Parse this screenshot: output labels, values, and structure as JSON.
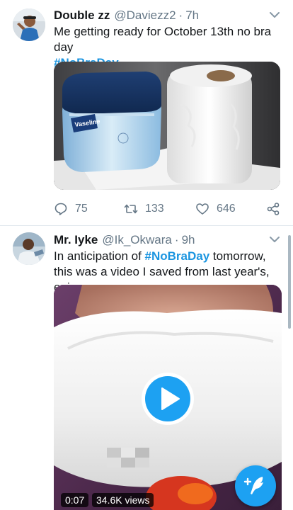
{
  "colors": {
    "accent": "#1b95e0",
    "text_primary": "#14171a",
    "text_secondary": "#657786",
    "divider": "#e1e8ed",
    "fab": "#1da1f2"
  },
  "tweets": [
    {
      "name": "Double zz",
      "handle": "@Daviezz2",
      "separator": "·",
      "time": "7h",
      "text": "Me getting ready for October 13th no bra day",
      "hashtag": "#NoBraDay",
      "media": {
        "type": "photo",
        "brand_label": "Vaseline"
      },
      "actions": {
        "replies": "75",
        "retweets": "133",
        "likes": "646",
        "reply_icon": "reply-icon",
        "retweet_icon": "retweet-icon",
        "like_icon": "heart-icon",
        "share_icon": "share-icon"
      }
    },
    {
      "name": "Mr. Iyke",
      "handle": "@Ik_Okwara",
      "separator": "·",
      "time": "9h",
      "text_before": "In anticipation of ",
      "hashtag": "#NoBraDay",
      "text_after": " tomorrow, this was a video I saved from last year's, enjoy.",
      "media": {
        "type": "video",
        "duration": "0:07",
        "views": "34.6K views",
        "play_icon": "play-icon"
      }
    }
  ],
  "fab": {
    "icon": "compose-tweet-icon"
  }
}
